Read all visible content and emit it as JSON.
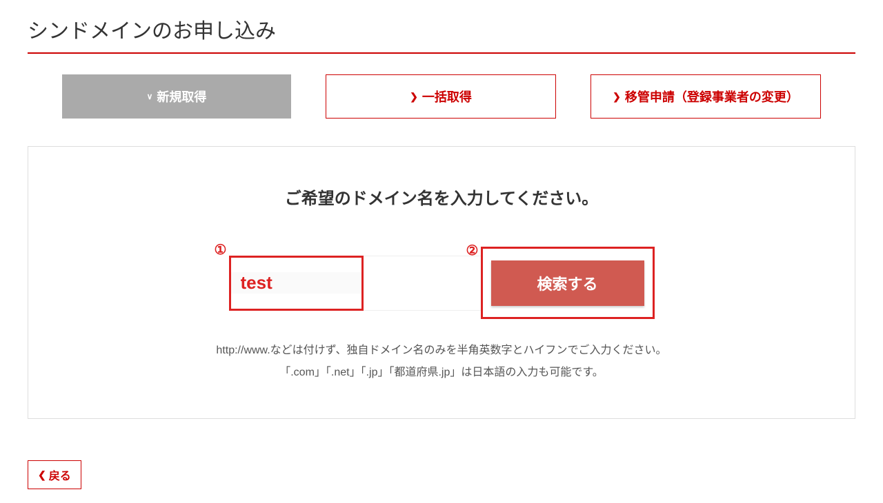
{
  "title": "シンドメインのお申し込み",
  "tabs": {
    "new": "新規取得",
    "bulk": "一括取得",
    "transfer": "移管申請（登録事業者の変更）"
  },
  "panel": {
    "heading": "ご希望のドメイン名を入力してください。",
    "badge1": "①",
    "badge2": "②",
    "input_value": "test",
    "search_label": "検索する",
    "hint1": "http://www.などは付けず、独自ドメイン名のみを半角英数字とハイフンでご入力ください。",
    "hint2": "「.com」「.net」「.jp」「都道府県.jp」は日本語の入力も可能です。"
  },
  "back_label": "戻る"
}
